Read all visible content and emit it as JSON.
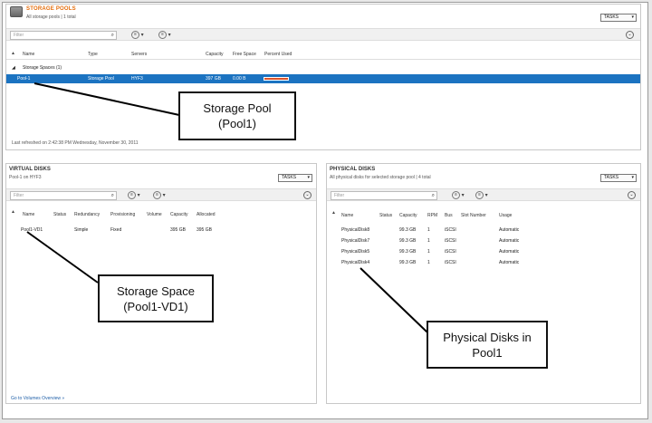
{
  "storage_pools": {
    "title": "STORAGE POOLS",
    "subtitle": "All storage pools | 1 total",
    "tasks_label": "TASKS",
    "filter_placeholder": "Filter",
    "columns": [
      "Name",
      "Type",
      "Servers",
      "Capacity",
      "Free Space",
      "Percent Used"
    ],
    "group_label": "Storage Spaces (1)",
    "row": {
      "name": "Pool-1",
      "type": "Storage Pool",
      "servers": "HYF3",
      "capacity": "397 GB",
      "free_space": "0.00 B",
      "percent_used": 1.0
    },
    "footer": "Last refreshed on 2:42:38 PM Wednesday, November 30, 2011"
  },
  "virtual_disks": {
    "title": "VIRTUAL DISKS",
    "subtitle": "Pool-1 on HYF3",
    "tasks_label": "TASKS",
    "filter_placeholder": "Filter",
    "columns": [
      "Name",
      "Status",
      "Redundancy",
      "Provisioning",
      "Volume",
      "Capacity",
      "Allocated"
    ],
    "row": {
      "name": "Pool1-VD1",
      "status": "",
      "redundancy": "Simple",
      "provisioning": "Fixed",
      "volume": "",
      "capacity": "395 GB",
      "allocated": "395 GB"
    },
    "footer_link": "Go to Volumes Overview »"
  },
  "physical_disks": {
    "title": "PHYSICAL DISKS",
    "subtitle": "All physical disks for selected storage pool | 4 total",
    "tasks_label": "TASKS",
    "filter_placeholder": "Filter",
    "columns": [
      "Name",
      "Status",
      "Capacity",
      "RPM",
      "Bus",
      "Slot Number",
      "Usage"
    ],
    "rows": [
      {
        "name": "PhysicalDisk8",
        "capacity": "99.3 GB",
        "rpm": "1",
        "bus": "iSCSI",
        "usage": "Automatic"
      },
      {
        "name": "PhysicalDisk7",
        "capacity": "99.3 GB",
        "rpm": "1",
        "bus": "iSCSI",
        "usage": "Automatic"
      },
      {
        "name": "PhysicalDisk5",
        "capacity": "99.3 GB",
        "rpm": "1",
        "bus": "iSCSI",
        "usage": "Automatic"
      },
      {
        "name": "PhysicalDisk4",
        "capacity": "99.3 GB",
        "rpm": "1",
        "bus": "iSCSI",
        "usage": "Automatic"
      }
    ]
  },
  "callouts": {
    "pool": "Storage Pool\n(Pool1)",
    "space": "Storage Space\n(Pool1-VD1)",
    "disks": "Physical Disks in\nPool1"
  },
  "icons": {
    "magnifier": "⌕",
    "chevron_down": "▾",
    "expand": "⌄",
    "sort_up": "▲",
    "collapse_group": "◢"
  },
  "colors": {
    "accent_title": "#e46c0a",
    "selection": "#1b73c1",
    "bar_fill": "#d9542c"
  }
}
